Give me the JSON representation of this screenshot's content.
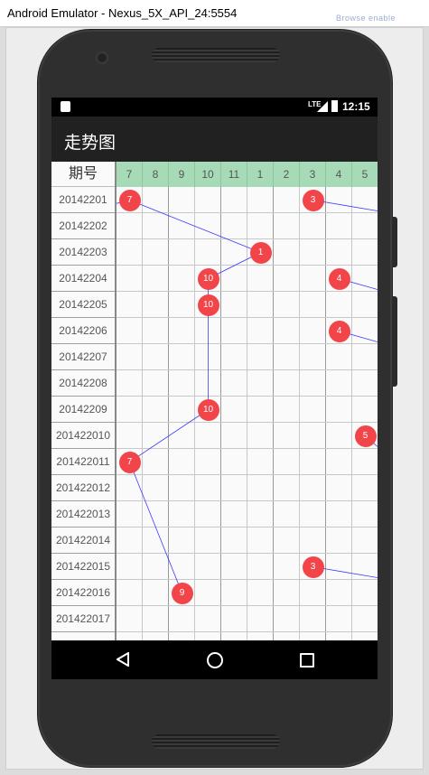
{
  "window": {
    "title": "Android Emulator - Nexus_5X_API_24:5554",
    "background_text": "Browse enable"
  },
  "statusbar": {
    "time": "12:15",
    "network": "LTE"
  },
  "app": {
    "title": "走势图"
  },
  "table": {
    "period_header": "期号",
    "numbers": [
      "7",
      "8",
      "9",
      "10",
      "11",
      "1",
      "2",
      "3",
      "4",
      "5"
    ],
    "periods": [
      "20142201",
      "20142202",
      "20142203",
      "20142204",
      "20142205",
      "20142206",
      "20142207",
      "20142208",
      "20142209",
      "201422010",
      "201422011",
      "201422012",
      "201422013",
      "201422014",
      "201422015",
      "201422016",
      "201422017"
    ],
    "primary_balls": [
      {
        "period": "20142201",
        "number": "7"
      },
      {
        "period": "20142203",
        "number": "1"
      },
      {
        "period": "20142204",
        "number": "10"
      },
      {
        "period": "20142205",
        "number": "10"
      },
      {
        "period": "20142209",
        "number": "10"
      },
      {
        "period": "201422011",
        "number": "7"
      },
      {
        "period": "201422016",
        "number": "9"
      }
    ],
    "secondary_balls": [
      {
        "period": "20142201",
        "number": "3"
      },
      {
        "period": "20142204",
        "number": "4"
      },
      {
        "period": "20142206",
        "number": "4"
      },
      {
        "period": "201422010",
        "number": "5"
      },
      {
        "period": "201422015",
        "number": "3"
      }
    ]
  },
  "colors": {
    "header_green": "#a7dbb7",
    "ball_red": "#f2454a",
    "trend_line": "#3b3bff"
  }
}
